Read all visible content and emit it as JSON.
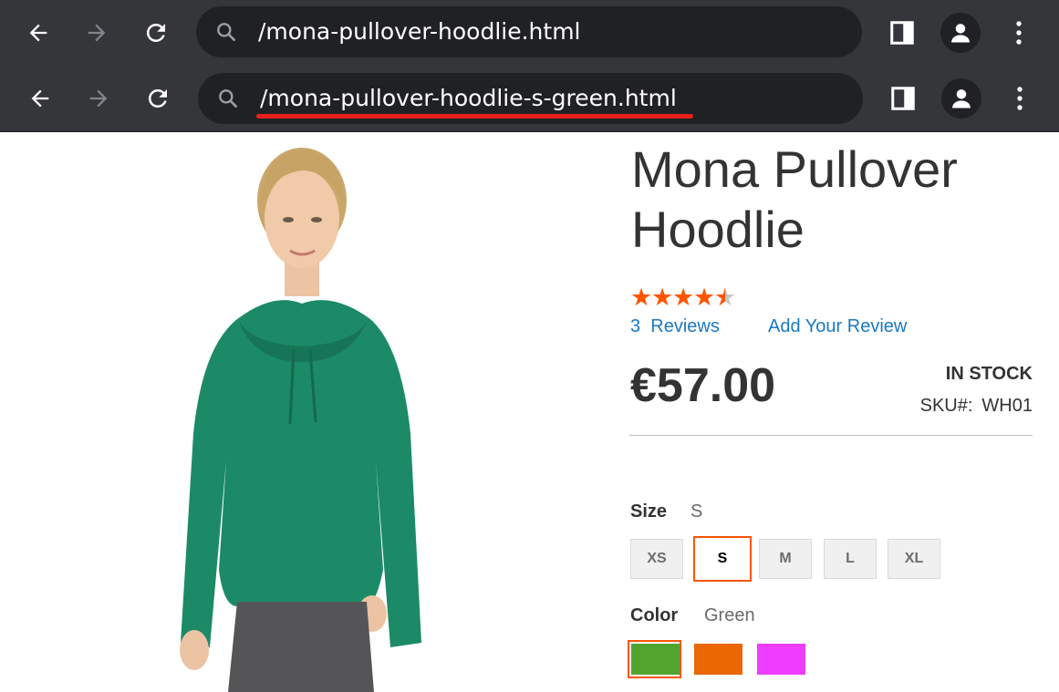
{
  "browser": {
    "urls": [
      "/mona-pullover-hoodlie.html",
      "/mona-pullover-hoodlie-s-green.html"
    ]
  },
  "product": {
    "title": "Mona Pullover Hoodlie",
    "rating": 4.5,
    "rating_max": 5,
    "reviews_count": "3",
    "reviews_label": "Reviews",
    "add_review_label": "Add Your Review",
    "price": "€57.00",
    "stock_status": "IN STOCK",
    "sku_label": "SKU#:",
    "sku": "WH01",
    "size": {
      "label": "Size",
      "selected": "S",
      "options": [
        "XS",
        "S",
        "M",
        "L",
        "XL"
      ]
    },
    "color": {
      "label": "Color",
      "selected": "Green",
      "swatch_colors": [
        "#53a42f",
        "#eb6703",
        "#ef3dff"
      ]
    }
  },
  "icons": {
    "back": "arrow-left-icon",
    "forward": "arrow-right-icon",
    "reload": "reload-icon",
    "search": "search-icon",
    "side_panel": "side-panel-icon",
    "profile": "profile-icon",
    "menu": "kebab-menu-icon"
  },
  "colors": {
    "chrome_bg": "#35363a",
    "omnibox_bg": "#202124",
    "accent": "#ff5501",
    "link": "#1979c3",
    "highlight_underline": "#e8201c"
  }
}
